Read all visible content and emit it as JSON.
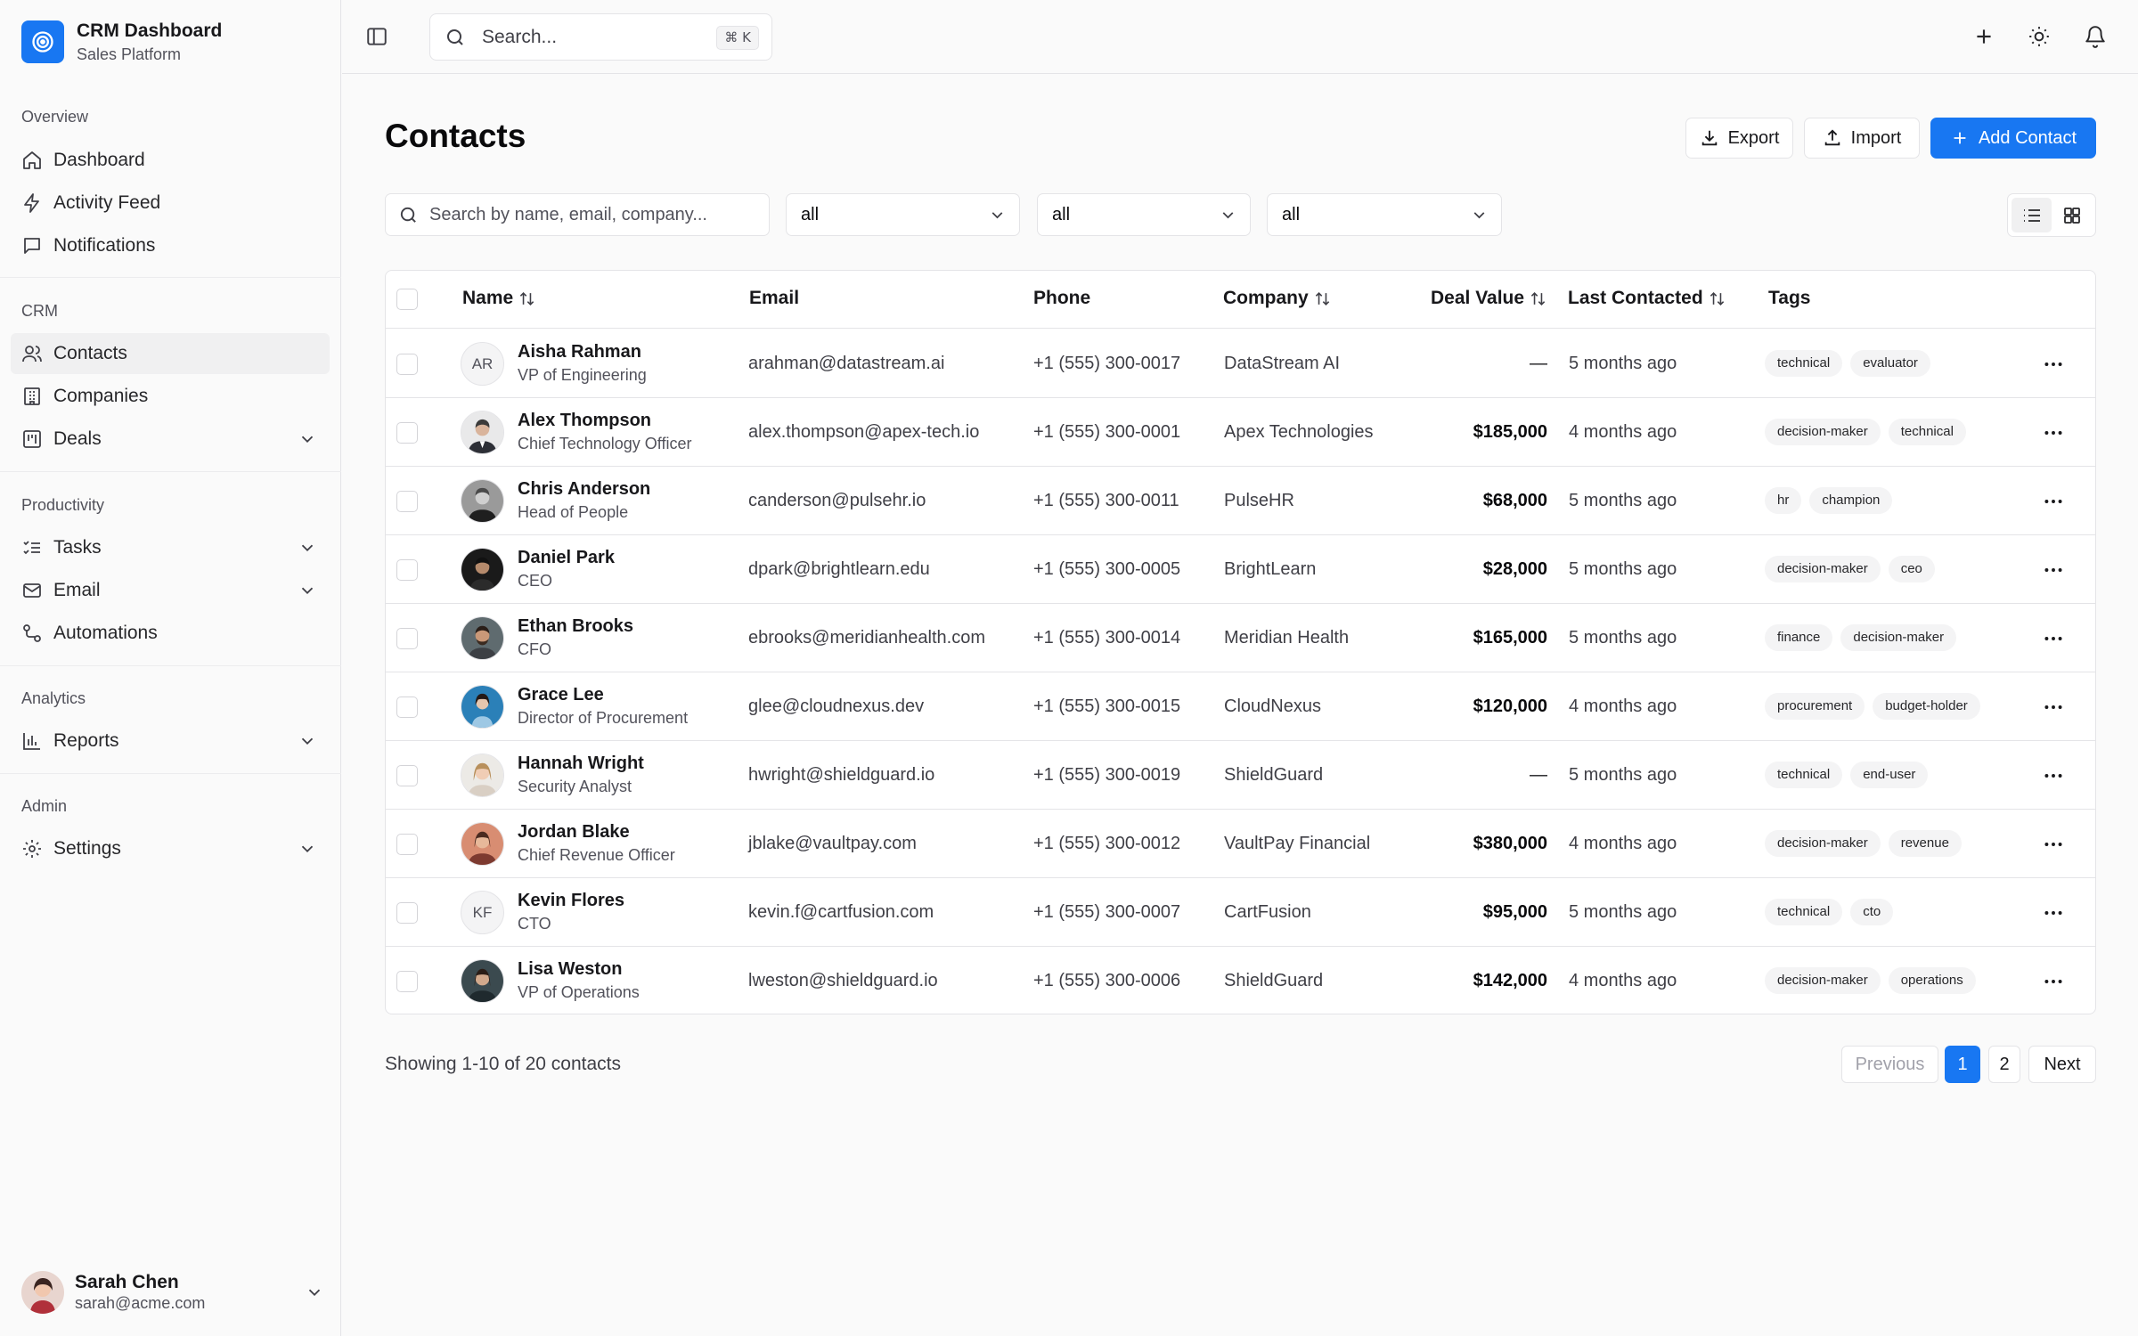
{
  "brand": {
    "title": "CRM Dashboard",
    "subtitle": "Sales Platform"
  },
  "sidebar": {
    "groups": [
      {
        "label": "Overview",
        "items": [
          {
            "label": "Dashboard",
            "icon": "home-icon"
          },
          {
            "label": "Activity Feed",
            "icon": "bolt-icon"
          },
          {
            "label": "Notifications",
            "icon": "message-square-icon"
          }
        ]
      },
      {
        "label": "CRM",
        "items": [
          {
            "label": "Contacts",
            "icon": "users-icon",
            "active": true
          },
          {
            "label": "Companies",
            "icon": "building-icon"
          },
          {
            "label": "Deals",
            "icon": "kanban-icon",
            "expandable": true
          }
        ]
      },
      {
        "label": "Productivity",
        "items": [
          {
            "label": "Tasks",
            "icon": "list-checks-icon",
            "expandable": true
          },
          {
            "label": "Email",
            "icon": "mail-icon",
            "expandable": true
          },
          {
            "label": "Automations",
            "icon": "workflow-icon"
          }
        ]
      },
      {
        "label": "Analytics",
        "items": [
          {
            "label": "Reports",
            "icon": "bar-chart-icon",
            "expandable": true
          }
        ]
      },
      {
        "label": "Admin",
        "items": [
          {
            "label": "Settings",
            "icon": "gear-icon",
            "expandable": true
          }
        ]
      }
    ],
    "user": {
      "name": "Sarah Chen",
      "email": "sarah@acme.com"
    }
  },
  "topbar": {
    "search_placeholder": "Search...",
    "search_shortcut": "⌘ K"
  },
  "page": {
    "title": "Contacts",
    "actions": {
      "export": "Export",
      "import": "Import",
      "add": "Add Contact"
    },
    "filters": {
      "search_placeholder": "Search by name, email, company...",
      "select_1": "all",
      "select_2": "all",
      "select_3": "all"
    }
  },
  "table": {
    "columns": {
      "name": "Name",
      "email": "Email",
      "phone": "Phone",
      "company": "Company",
      "deal_value": "Deal Value",
      "last_contacted": "Last Contacted",
      "tags": "Tags"
    },
    "rows": [
      {
        "initials": "AR",
        "name": "Aisha Rahman",
        "title": "VP of Engineering",
        "email": "arahman@datastream.ai",
        "phone": "+1 (555) 300-0017",
        "company": "DataStream AI",
        "deal": "—",
        "last": "5 months ago",
        "tags": [
          "technical",
          "evaluator"
        ]
      },
      {
        "initials": "",
        "name": "Alex Thompson",
        "title": "Chief Technology Officer",
        "email": "alex.thompson@apex-tech.io",
        "phone": "+1 (555) 300-0001",
        "company": "Apex Technologies",
        "deal": "$185,000",
        "last": "4 months ago",
        "tags": [
          "decision-maker",
          "technical"
        ]
      },
      {
        "initials": "",
        "name": "Chris Anderson",
        "title": "Head of People",
        "email": "canderson@pulsehr.io",
        "phone": "+1 (555) 300-0011",
        "company": "PulseHR",
        "deal": "$68,000",
        "last": "5 months ago",
        "tags": [
          "hr",
          "champion"
        ]
      },
      {
        "initials": "",
        "name": "Daniel Park",
        "title": "CEO",
        "email": "dpark@brightlearn.edu",
        "phone": "+1 (555) 300-0005",
        "company": "BrightLearn",
        "deal": "$28,000",
        "last": "5 months ago",
        "tags": [
          "decision-maker",
          "ceo"
        ]
      },
      {
        "initials": "",
        "name": "Ethan Brooks",
        "title": "CFO",
        "email": "ebrooks@meridianhealth.com",
        "phone": "+1 (555) 300-0014",
        "company": "Meridian Health",
        "deal": "$165,000",
        "last": "5 months ago",
        "tags": [
          "finance",
          "decision-maker"
        ]
      },
      {
        "initials": "",
        "name": "Grace Lee",
        "title": "Director of Procurement",
        "email": "glee@cloudnexus.dev",
        "phone": "+1 (555) 300-0015",
        "company": "CloudNexus",
        "deal": "$120,000",
        "last": "4 months ago",
        "tags": [
          "procurement",
          "budget-holder"
        ]
      },
      {
        "initials": "",
        "name": "Hannah Wright",
        "title": "Security Analyst",
        "email": "hwright@shieldguard.io",
        "phone": "+1 (555) 300-0019",
        "company": "ShieldGuard",
        "deal": "—",
        "last": "5 months ago",
        "tags": [
          "technical",
          "end-user"
        ]
      },
      {
        "initials": "",
        "name": "Jordan Blake",
        "title": "Chief Revenue Officer",
        "email": "jblake@vaultpay.com",
        "phone": "+1 (555) 300-0012",
        "company": "VaultPay Financial",
        "deal": "$380,000",
        "last": "4 months ago",
        "tags": [
          "decision-maker",
          "revenue"
        ]
      },
      {
        "initials": "KF",
        "name": "Kevin Flores",
        "title": "CTO",
        "email": "kevin.f@cartfusion.com",
        "phone": "+1 (555) 300-0007",
        "company": "CartFusion",
        "deal": "$95,000",
        "last": "5 months ago",
        "tags": [
          "technical",
          "cto"
        ]
      },
      {
        "initials": "",
        "name": "Lisa Weston",
        "title": "VP of Operations",
        "email": "lweston@shieldguard.io",
        "phone": "+1 (555) 300-0006",
        "company": "ShieldGuard",
        "deal": "$142,000",
        "last": "4 months ago",
        "tags": [
          "decision-maker",
          "operations"
        ]
      }
    ]
  },
  "footer": {
    "showing": "Showing 1-10 of 20 contacts",
    "prev": "Previous",
    "page1": "1",
    "page2": "2",
    "next": "Next"
  },
  "colors": {
    "accent": "#1877f2",
    "border": "#e4e4e7",
    "text": "#18181b",
    "muted": "#52525b"
  }
}
